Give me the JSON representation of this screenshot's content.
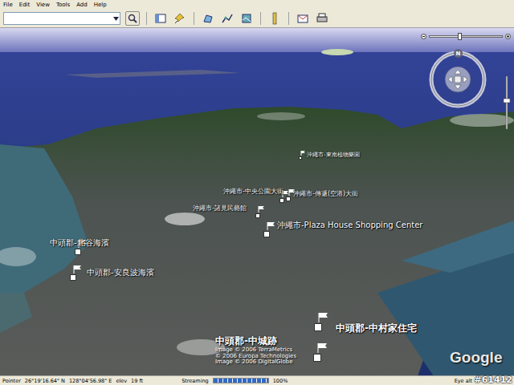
{
  "menu": [
    "File",
    "Edit",
    "View",
    "Tools",
    "Add",
    "Help"
  ],
  "search": {
    "value": ""
  },
  "map": {
    "placemarks": [
      {
        "label": "中頭郡-北谷海濱",
        "kind": "mid"
      },
      {
        "label": "中頭郡-安良波海濱",
        "kind": "mid"
      },
      {
        "label": "沖繩市-中央公園大街",
        "kind": "small"
      },
      {
        "label": "沖繩市-傳遞(空港)大街",
        "kind": "small"
      },
      {
        "label": "沖繩市-諸見民藝館",
        "kind": "small"
      },
      {
        "label": "沖繩市-Plaza House Shopping Center",
        "kind": "mid"
      },
      {
        "label": "沖繩市-東南植物樂園",
        "kind": "far"
      },
      {
        "label": "中頭郡-中村家住宅",
        "kind": "near"
      },
      {
        "label": "中頭郡-中城跡",
        "kind": "near"
      }
    ],
    "compass": {
      "north": "N"
    },
    "zoom": {
      "level": 0.42
    },
    "copyright": [
      "Image © 2006 TerraMetrics",
      "© 2006 Europa Technologies",
      "Image © 2006 DigitalGlobe"
    ],
    "logo": "Google"
  },
  "status_bar": {
    "pointer_label": "Pointer",
    "lat": "26°19'16.64\" N",
    "lon": "128°04'56.98\" E",
    "elev_label": "elev",
    "elev": "19 ft",
    "streaming_label": "Streaming",
    "streaming_level": 1,
    "streaming_percent": "100%",
    "eye_alt_label": "Eye alt"
  },
  "watermark": "#61412"
}
